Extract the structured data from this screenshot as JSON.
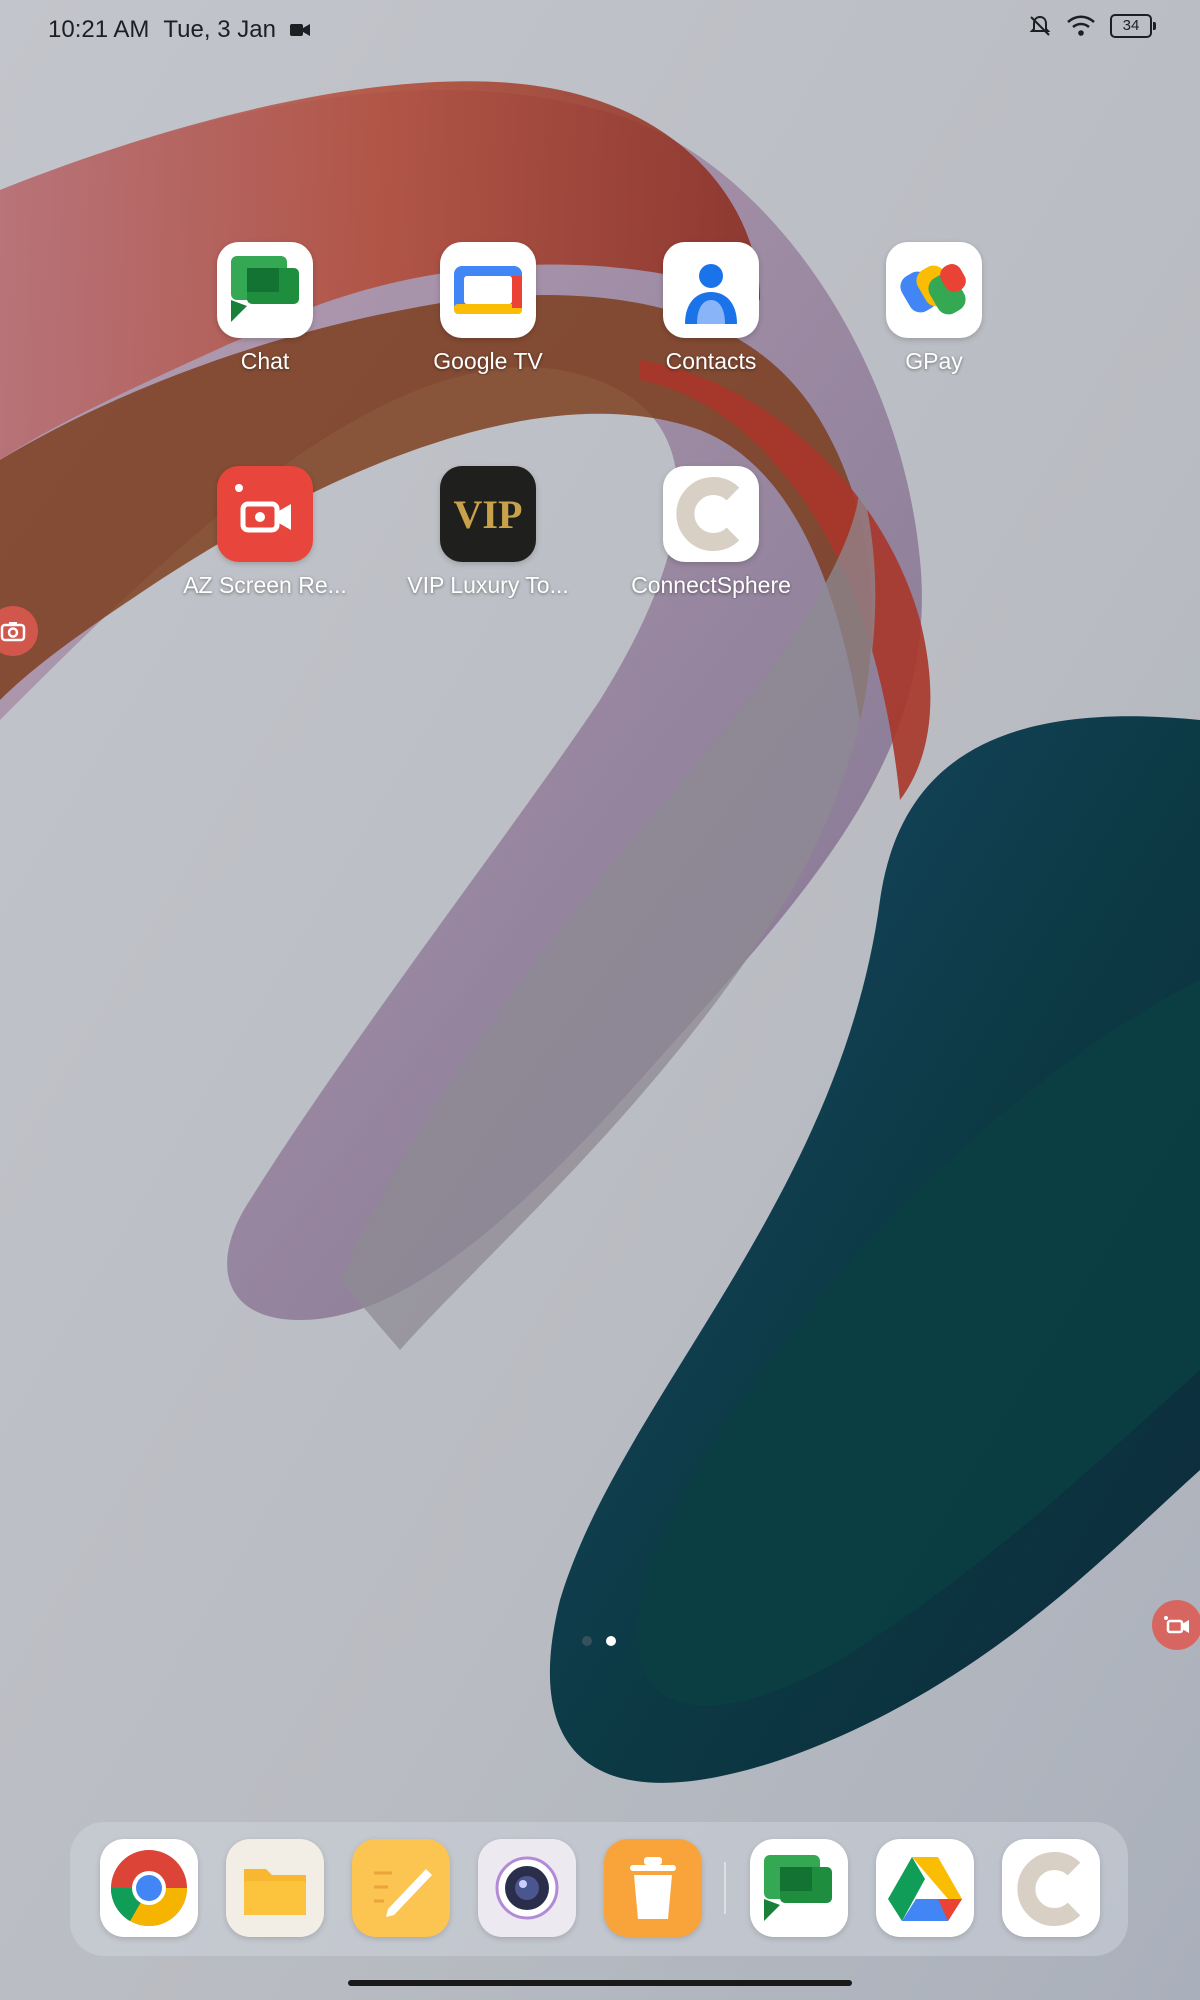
{
  "status_bar": {
    "time": "10:21 AM",
    "date": "Tue, 3 Jan",
    "battery": "34",
    "icons": [
      "video-record-icon",
      "bell-muted-icon",
      "wifi-icon",
      "battery-icon"
    ]
  },
  "home_apps": [
    {
      "label": "Chat",
      "icon": "google-chat-icon"
    },
    {
      "label": "Google TV",
      "icon": "google-tv-icon"
    },
    {
      "label": "Contacts",
      "icon": "contacts-icon"
    },
    {
      "label": "GPay",
      "icon": "gpay-icon"
    },
    {
      "label": "AZ Screen Re...",
      "icon": "az-screen-recorder-icon"
    },
    {
      "label": "VIP Luxury To...",
      "icon": "vip-luxury-icon"
    },
    {
      "label": "ConnectSphere",
      "icon": "connectsphere-icon"
    }
  ],
  "floating_buttons": [
    "screenshot-float-icon",
    "screen-record-float-icon"
  ],
  "page_indicator": {
    "pages": 2,
    "current": 2
  },
  "dock": [
    "chrome-icon",
    "files-icon",
    "notes-icon",
    "camera-icon",
    "cleaner-icon",
    "google-chat-icon",
    "google-drive-icon",
    "connectsphere-icon"
  ],
  "colors": {
    "label_text": "#ffffff",
    "status_text": "#1d1f22",
    "az_red": "#e8463d"
  }
}
